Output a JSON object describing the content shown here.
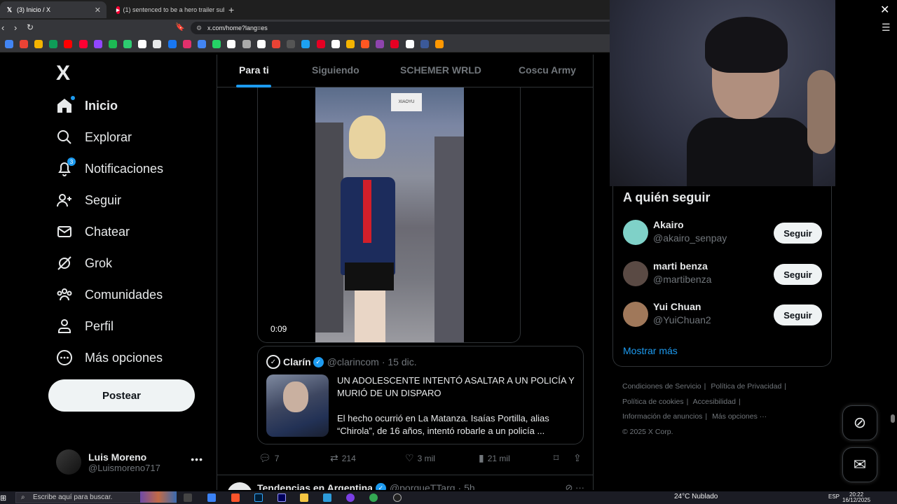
{
  "browser": {
    "tabs": [
      {
        "label": "(3) Inicio / X",
        "favicon": "x-icon",
        "active": true
      },
      {
        "label": "(1) sentenced to be a hero trailer sub",
        "favicon": "youtube-icon",
        "active": false
      }
    ],
    "new_tab": "+",
    "url": "x.com/home?lang=es",
    "bookmark_colors": [
      "#4285f4",
      "#ea4335",
      "#f4b400",
      "#0f9d58",
      "#ff0000",
      "#ff0033",
      "#9146ff",
      "#1db954",
      "#2ecc71",
      "#ffffff",
      "#e7e9ea",
      "#1877f2",
      "#e1306c",
      "#4285f4",
      "#25d366",
      "#ffffff",
      "#aaaaaa",
      "#ffffff",
      "#ea4335",
      "#555555",
      "#1da1f2",
      "#e60023",
      "#ffffff",
      "#f4b400",
      "#ff5722",
      "#8e44ad",
      "#e60023",
      "#ffffff",
      "#3b5998",
      "#ff9800"
    ]
  },
  "nav": {
    "logo": "X",
    "items": [
      {
        "label": "Inicio",
        "icon": "home-icon",
        "active": true
      },
      {
        "label": "Explorar",
        "icon": "search-icon"
      },
      {
        "label": "Notificaciones",
        "icon": "bell-icon",
        "badge": "3"
      },
      {
        "label": "Seguir",
        "icon": "person-add-icon"
      },
      {
        "label": "Chatear",
        "icon": "mail-icon"
      },
      {
        "label": "Grok",
        "icon": "grok-icon"
      },
      {
        "label": "Comunidades",
        "icon": "people-icon"
      },
      {
        "label": "Perfil",
        "icon": "person-icon"
      },
      {
        "label": "Más opciones",
        "icon": "more-circle-icon"
      }
    ],
    "post_button": "Postear",
    "profile": {
      "name": "Luis Moreno",
      "handle": "@Luismoreno717",
      "more": "•••"
    }
  },
  "feed_tabs": [
    "Para ti",
    "Siguiendo",
    "SCHEMER WRLD",
    "Coscu Army"
  ],
  "video": {
    "duration": "0:09",
    "sign_text": "XIAOYU"
  },
  "quote": {
    "name": "Clarín",
    "handle": "@clarincom",
    "date": "· 15 dic.",
    "title": "UN ADOLESCENTE INTENTÓ ASALTAR A UN POLICÍA Y MURIÓ DE UN DISPARO",
    "body": "El hecho ocurrió en La Matanza. Isaías Portilla, alias “Chirola”, de 16 años, intentó robarle a un policía ..."
  },
  "actions": {
    "replies": "7",
    "reposts": "214",
    "likes": "3 mil",
    "views": "21 mil"
  },
  "next_post": {
    "name": "Tendencias en Argentina",
    "handle": "@porqueTTarg",
    "time": "· 5h"
  },
  "who_to_follow": {
    "title": "A quién seguir",
    "users": [
      {
        "name": "Akairo",
        "handle": "@akairo_senpay",
        "button": "Seguir",
        "color": "#7fd1c8"
      },
      {
        "name": "marti benza",
        "handle": "@martibenza",
        "button": "Seguir",
        "color": "#5a4a44"
      },
      {
        "name": "Yui Chuan",
        "handle": "@YuiChuan2",
        "button": "Seguir",
        "color": "#a0785a"
      }
    ],
    "show_more": "Mostrar más"
  },
  "footer": {
    "links": [
      "Condiciones de Servicio",
      "|",
      "Política de Privacidad",
      "|",
      "Política de cookies",
      "|",
      "Accesibilidad",
      "|",
      "Información de anuncios",
      "|",
      "Más opciones ···"
    ],
    "copyright": "© 2025 X Corp."
  },
  "taskbar": {
    "search_placeholder": "Escribe aquí para buscar.",
    "weather": "24°C  Nublado",
    "lang": "ESP",
    "time": "20:22",
    "date": "16/12/2025"
  },
  "accent": "#1d9bf0"
}
